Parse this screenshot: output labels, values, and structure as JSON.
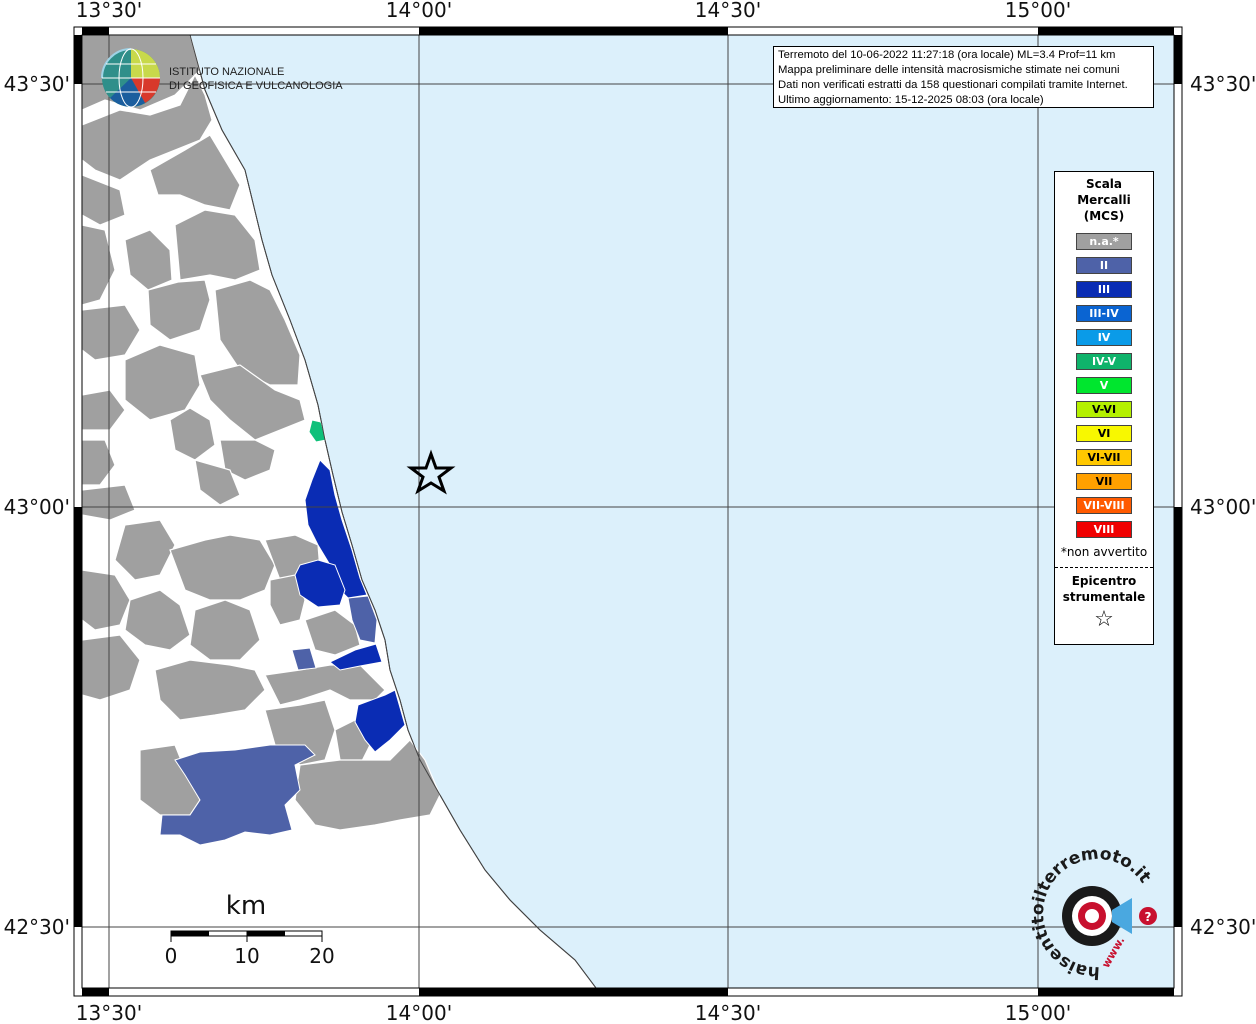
{
  "map": {
    "lon_labels": [
      "13°30'",
      "14°00'",
      "14°30'",
      "15°00'"
    ],
    "lat_labels": [
      "43°30'",
      "43°00'",
      "42°30'"
    ],
    "colors": {
      "sea": "#dcf0fb",
      "not_felt": "#a0a0a0",
      "II": "#4e62a8",
      "III": "#0a2cb4",
      "IV-V": "#0fc07a"
    }
  },
  "logo": {
    "line1": "ISTITUTO NAZIONALE",
    "line2": "DI GEOFISICA E VULCANOLOGIA"
  },
  "info": {
    "line1": "Terremoto del 10-06-2022 11:27:18 (ora locale) ML=3.4 Prof=11 km",
    "line2": "Mappa preliminare delle intensità macrosismiche stimate nei comuni",
    "line3": "Dati non verificati estratti da 158 questionari compilati tramite Internet.",
    "line4": "Ultimo aggiornamento: 15-12-2025 08:03 (ora locale)"
  },
  "legend": {
    "title_1": "Scala",
    "title_2": "Mercalli",
    "title_3": "(MCS)",
    "items": [
      {
        "label": "n.a.*",
        "color": "#a0a0a0"
      },
      {
        "label": "II",
        "color": "#4e62a8"
      },
      {
        "label": "III",
        "color": "#0a2cb4"
      },
      {
        "label": "III-IV",
        "color": "#0a64d2"
      },
      {
        "label": "IV",
        "color": "#0a9be8"
      },
      {
        "label": "IV-V",
        "color": "#0fb36b"
      },
      {
        "label": "V",
        "color": "#00e62e"
      },
      {
        "label": "V-VI",
        "color": "#b4f000"
      },
      {
        "label": "VI",
        "color": "#f8f800"
      },
      {
        "label": "VI-VII",
        "color": "#ffc800"
      },
      {
        "label": "VII",
        "color": "#ffa000"
      },
      {
        "label": "VII-VIII",
        "color": "#ff5a00"
      },
      {
        "label": "VIII",
        "color": "#f00000"
      }
    ],
    "note": "*non avvertito",
    "epicenter_1": "Epicentro",
    "epicenter_2": "strumentale"
  },
  "scale_bar": {
    "unit": "km",
    "ticks": [
      "0",
      "10",
      "20"
    ]
  },
  "watermark": {
    "text": "haisentitoilterremoto.it",
    "url": "www."
  }
}
